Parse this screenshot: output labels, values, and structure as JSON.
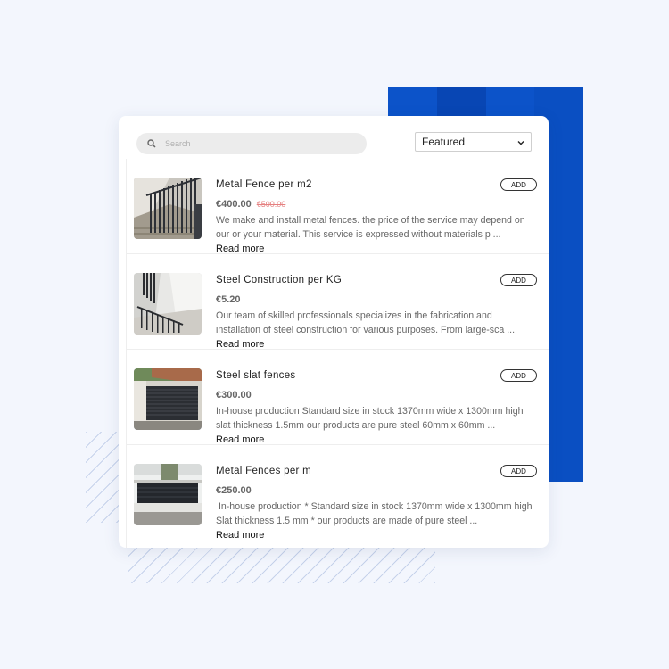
{
  "search": {
    "placeholder": "Search"
  },
  "sort": {
    "selected": "Featured"
  },
  "products": [
    {
      "title": "Metal Fence per m2",
      "price": "€400.00",
      "old_price": "€500.00",
      "desc_line1": "We make and install metal fences. the price of the service may depend on",
      "desc_line2": "our or your material. This service is expressed without materials p ...",
      "read_more": "Read more",
      "add_label": "ADD"
    },
    {
      "title": "Steel Construction per KG",
      "price": "€5.20",
      "old_price": "",
      "desc_line1": "Our team of skilled professionals specializes in the fabrication and",
      "desc_line2": "installation of steel construction for various purposes. From large-sca ...",
      "read_more": "Read more",
      "add_label": "ADD"
    },
    {
      "title": "Steel slat fences",
      "price": "€300.00",
      "old_price": "",
      "desc_line1": "In-house production Standard size in stock 1370mm wide x 1300mm high",
      "desc_line2": "slat thickness 1.5mm our products are pure steel 60mm x 60mm ...",
      "read_more": "Read more",
      "add_label": "ADD"
    },
    {
      "title": "Metal Fences per m",
      "price": "€250.00",
      "old_price": "",
      "desc_line1": " In-house production * Standard size in stock 1370mm wide x 1300mm high",
      "desc_line2": "Slat thickness 1.5 mm * our products are made of pure steel ...",
      "read_more": "Read more",
      "add_label": "ADD"
    }
  ]
}
